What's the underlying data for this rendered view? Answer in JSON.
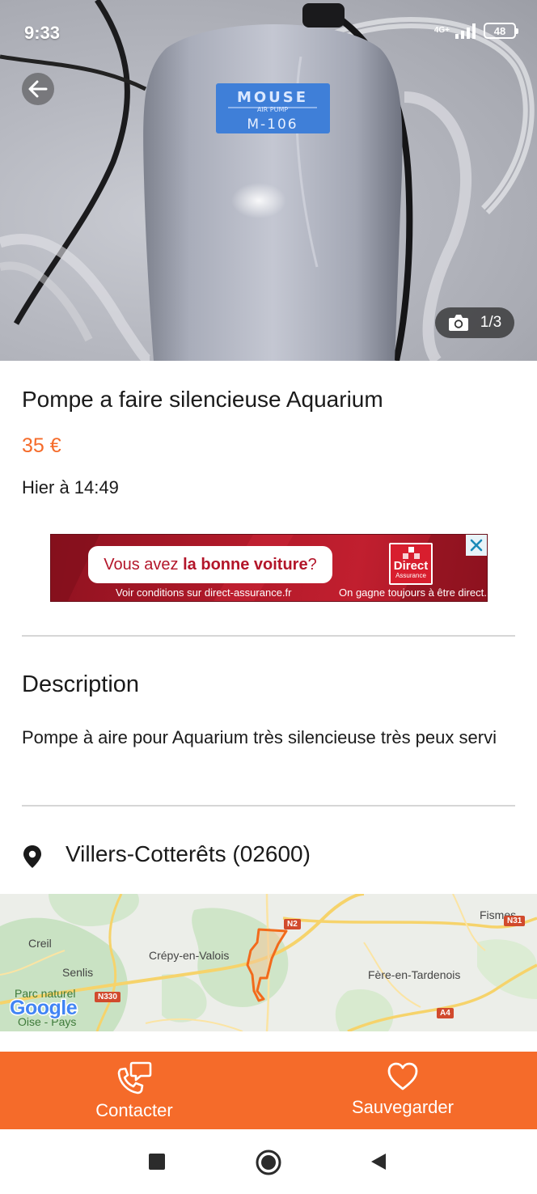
{
  "status_bar": {
    "time": "9:33",
    "network": "4G+",
    "battery": "48"
  },
  "photo": {
    "brand_line1": "MOUSE",
    "brand_line2": "AIR PUMP",
    "brand_line3": "M-106",
    "counter": "1/3"
  },
  "listing": {
    "title": "Pompe a faire silencieuse Aquarium",
    "price": "35 €",
    "date": "Hier à 14:49"
  },
  "ad": {
    "text_prefix": "Vous avez ",
    "text_bold": "la bonne voiture",
    "text_suffix": " ?",
    "subtext": "Voir conditions sur direct-assurance.fr",
    "slogan": "On gagne toujours à être direct.",
    "logo_line1": "Direct",
    "logo_line2": "Assurance"
  },
  "description": {
    "heading": "Description",
    "text": "Pompe à aire pour Aquarium très silencieuse très peux servi"
  },
  "location": {
    "city": "Villers-Cotterêts (02600)"
  },
  "map": {
    "labels": {
      "fismes": "Fismes",
      "creil": "Creil",
      "crepy": "Crépy-en-Valois",
      "senlis": "Senlis",
      "fere": "Fère-en-Tardenois",
      "parc": "Parc naturel",
      "oise": "Oise - Pays"
    },
    "roads": {
      "n2": "N2",
      "n31": "N31",
      "n330": "N330",
      "a4": "A4"
    },
    "attribution": "Google"
  },
  "actions": {
    "contact": "Contacter",
    "save": "Sauvegarder"
  },
  "colors": {
    "accent": "#f56b2a",
    "ad_red": "#b31a2a"
  }
}
